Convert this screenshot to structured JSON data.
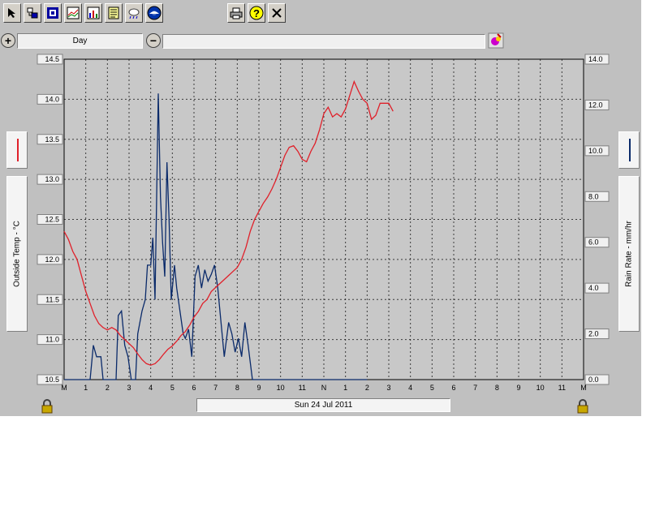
{
  "toolbar": {
    "buttons": [
      {
        "name": "pointer-tool-icon"
      },
      {
        "name": "data-select-icon"
      },
      {
        "name": "station-icon"
      },
      {
        "name": "graph-icon"
      },
      {
        "name": "bar-chart-icon"
      },
      {
        "name": "notes-icon"
      },
      {
        "name": "weather-cloud-icon"
      },
      {
        "name": "noaa-logo-icon"
      },
      {
        "name": "print-icon"
      },
      {
        "name": "help-icon"
      },
      {
        "name": "close-icon"
      }
    ]
  },
  "zoom": {
    "period_label": "Day",
    "zoom_in_symbol": "+",
    "zoom_out_symbol": "−"
  },
  "axes": {
    "left_label": "Outside Temp - °C",
    "right_label": "Rain Rate - mm/hr",
    "date_label": "Sun 24 Jul 2011"
  },
  "colors": {
    "temp": "#e0202a",
    "rain": "#0a2a6a",
    "plot_bg": "#c8c8c8"
  },
  "chart_data": {
    "type": "line",
    "x_ticks": [
      "M",
      "1",
      "2",
      "3",
      "4",
      "5",
      "6",
      "7",
      "8",
      "9",
      "10",
      "11",
      "N",
      "1",
      "2",
      "3",
      "4",
      "5",
      "6",
      "7",
      "8",
      "9",
      "10",
      "11",
      "M"
    ],
    "x_range_hours": [
      0,
      24
    ],
    "y_left": {
      "label": "Outside Temp - °C",
      "range": [
        10.5,
        14.5
      ],
      "ticks": [
        "10.5",
        "11.0",
        "11.5",
        "12.0",
        "12.5",
        "13.0",
        "13.5",
        "14.0",
        "14.5"
      ]
    },
    "y_right": {
      "label": "Rain Rate - mm/hr",
      "range": [
        0,
        14
      ],
      "ticks": [
        "0.0",
        "2.0",
        "4.0",
        "6.0",
        "8.0",
        "10.0",
        "12.0",
        "14.0"
      ]
    },
    "grid": true,
    "series": [
      {
        "name": "Outside Temp - °C",
        "axis": "left",
        "points": [
          [
            0,
            12.35
          ],
          [
            0.2,
            12.25
          ],
          [
            0.4,
            12.1
          ],
          [
            0.6,
            12.0
          ],
          [
            0.8,
            11.8
          ],
          [
            1.0,
            11.6
          ],
          [
            1.2,
            11.45
          ],
          [
            1.4,
            11.3
          ],
          [
            1.6,
            11.2
          ],
          [
            1.8,
            11.15
          ],
          [
            2.0,
            11.12
          ],
          [
            2.2,
            11.15
          ],
          [
            2.4,
            11.12
          ],
          [
            2.6,
            11.05
          ],
          [
            2.8,
            11.0
          ],
          [
            3.0,
            10.95
          ],
          [
            3.2,
            10.9
          ],
          [
            3.4,
            10.82
          ],
          [
            3.6,
            10.75
          ],
          [
            3.8,
            10.7
          ],
          [
            4.0,
            10.68
          ],
          [
            4.2,
            10.7
          ],
          [
            4.4,
            10.75
          ],
          [
            4.6,
            10.82
          ],
          [
            4.8,
            10.88
          ],
          [
            5.0,
            10.92
          ],
          [
            5.2,
            10.98
          ],
          [
            5.4,
            11.05
          ],
          [
            5.6,
            11.1
          ],
          [
            5.8,
            11.18
          ],
          [
            6.0,
            11.28
          ],
          [
            6.2,
            11.35
          ],
          [
            6.4,
            11.45
          ],
          [
            6.6,
            11.5
          ],
          [
            6.8,
            11.6
          ],
          [
            7.0,
            11.65
          ],
          [
            7.2,
            11.7
          ],
          [
            7.4,
            11.75
          ],
          [
            7.6,
            11.8
          ],
          [
            7.8,
            11.85
          ],
          [
            8.0,
            11.9
          ],
          [
            8.2,
            12.0
          ],
          [
            8.4,
            12.15
          ],
          [
            8.6,
            12.35
          ],
          [
            8.8,
            12.5
          ],
          [
            9.0,
            12.6
          ],
          [
            9.2,
            12.7
          ],
          [
            9.4,
            12.78
          ],
          [
            9.6,
            12.88
          ],
          [
            9.8,
            13.0
          ],
          [
            10.0,
            13.15
          ],
          [
            10.2,
            13.3
          ],
          [
            10.4,
            13.4
          ],
          [
            10.6,
            13.42
          ],
          [
            10.8,
            13.35
          ],
          [
            11.0,
            13.25
          ],
          [
            11.2,
            13.22
          ],
          [
            11.4,
            13.35
          ],
          [
            11.6,
            13.45
          ],
          [
            11.8,
            13.62
          ],
          [
            12.0,
            13.82
          ],
          [
            12.2,
            13.9
          ],
          [
            12.4,
            13.78
          ],
          [
            12.6,
            13.82
          ],
          [
            12.8,
            13.78
          ],
          [
            13.0,
            13.88
          ],
          [
            13.2,
            14.05
          ],
          [
            13.4,
            14.22
          ],
          [
            13.6,
            14.1
          ],
          [
            13.8,
            14.0
          ],
          [
            14.0,
            13.95
          ],
          [
            14.2,
            13.75
          ],
          [
            14.4,
            13.8
          ],
          [
            14.6,
            13.95
          ],
          [
            14.8,
            13.95
          ],
          [
            15.0,
            13.95
          ],
          [
            15.2,
            13.85
          ]
        ]
      },
      {
        "name": "Rain Rate - mm/hr",
        "axis": "right",
        "points": [
          [
            0,
            0
          ],
          [
            1.2,
            0
          ],
          [
            1.35,
            1.5
          ],
          [
            1.5,
            1.0
          ],
          [
            1.7,
            1.0
          ],
          [
            1.8,
            0
          ],
          [
            2.4,
            0
          ],
          [
            2.5,
            2.8
          ],
          [
            2.65,
            3.0
          ],
          [
            2.8,
            1.5
          ],
          [
            2.95,
            1.0
          ],
          [
            3.1,
            0
          ],
          [
            3.3,
            0
          ],
          [
            3.4,
            2.0
          ],
          [
            3.6,
            3.0
          ],
          [
            3.75,
            3.5
          ],
          [
            3.85,
            5.0
          ],
          [
            4.0,
            5.0
          ],
          [
            4.1,
            6.2
          ],
          [
            4.2,
            3.5
          ],
          [
            4.35,
            12.5
          ],
          [
            4.45,
            8.0
          ],
          [
            4.55,
            6.0
          ],
          [
            4.65,
            4.5
          ],
          [
            4.75,
            9.5
          ],
          [
            4.85,
            7.0
          ],
          [
            4.95,
            3.5
          ],
          [
            5.1,
            5.0
          ],
          [
            5.2,
            4.0
          ],
          [
            5.35,
            3.0
          ],
          [
            5.5,
            2.0
          ],
          [
            5.6,
            1.8
          ],
          [
            5.75,
            2.2
          ],
          [
            5.9,
            1.0
          ],
          [
            6.05,
            4.5
          ],
          [
            6.2,
            5.0
          ],
          [
            6.35,
            4.0
          ],
          [
            6.5,
            4.8
          ],
          [
            6.65,
            4.3
          ],
          [
            6.8,
            4.6
          ],
          [
            6.95,
            5.0
          ],
          [
            7.1,
            4.0
          ],
          [
            7.25,
            2.5
          ],
          [
            7.4,
            1.0
          ],
          [
            7.6,
            2.5
          ],
          [
            7.75,
            2.0
          ],
          [
            7.9,
            1.2
          ],
          [
            8.05,
            1.8
          ],
          [
            8.2,
            1.0
          ],
          [
            8.35,
            2.5
          ],
          [
            8.5,
            1.5
          ],
          [
            8.7,
            0
          ],
          [
            14.0,
            0
          ]
        ]
      }
    ]
  }
}
